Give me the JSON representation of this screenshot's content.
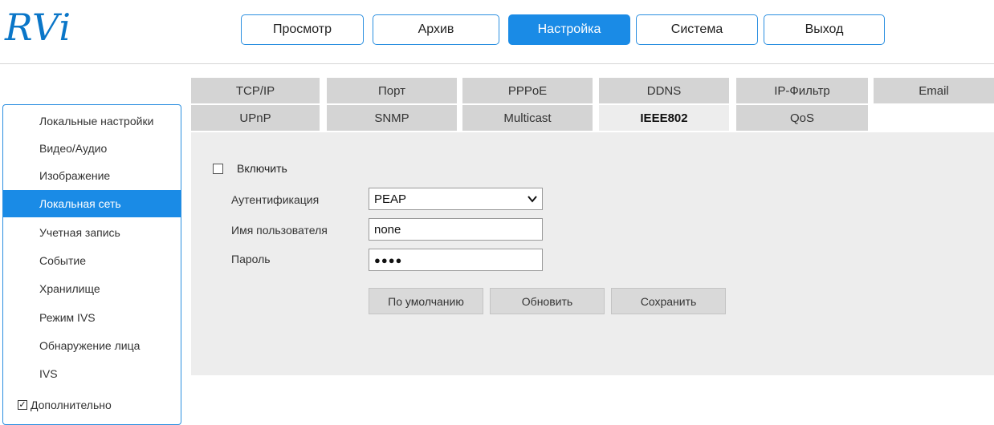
{
  "brand": {
    "logo_text": "RVi"
  },
  "nav": {
    "items": [
      {
        "label": "Просмотр"
      },
      {
        "label": "Архив"
      },
      {
        "label": "Настройка"
      },
      {
        "label": "Система"
      },
      {
        "label": "Выход"
      }
    ],
    "active": "Настройка"
  },
  "sidebar": {
    "items": [
      {
        "label": "Локальные настройки"
      },
      {
        "label": "Видео/Аудио"
      },
      {
        "label": "Изображение"
      },
      {
        "label": "Локальная сеть"
      },
      {
        "label": "Учетная запись"
      },
      {
        "label": "Событие"
      },
      {
        "label": "Хранилище"
      },
      {
        "label": "Режим IVS"
      },
      {
        "label": "Обнаружение лица"
      },
      {
        "label": "IVS"
      },
      {
        "label": "Дополнительно"
      }
    ],
    "active": "Локальная сеть",
    "advanced_checked": "✓"
  },
  "tabs": {
    "row1": [
      {
        "label": "TCP/IP"
      },
      {
        "label": "Порт"
      },
      {
        "label": "PPPoE"
      },
      {
        "label": "DDNS"
      },
      {
        "label": "IP-Фильтр"
      },
      {
        "label": "Email"
      }
    ],
    "row2": [
      {
        "label": "UPnP"
      },
      {
        "label": "SNMP"
      },
      {
        "label": "Multicast"
      },
      {
        "label": "IEEE802"
      },
      {
        "label": "QoS"
      }
    ],
    "active": "IEEE802"
  },
  "form": {
    "enable_label": "Включить",
    "enable_checked": false,
    "auth_label": "Аутентификация",
    "auth_value": "PEAP",
    "username_label": "Имя пользователя",
    "username_value": "none",
    "password_label": "Пароль",
    "password_value": "●●●●"
  },
  "actions": {
    "default_label": "По умолчанию",
    "refresh_label": "Обновить",
    "save_label": "Сохранить"
  },
  "colors": {
    "accent": "#1a8be6",
    "border": "#2b8fe0",
    "tab_bg": "#d4d4d4",
    "panel_bg": "#ededed"
  }
}
